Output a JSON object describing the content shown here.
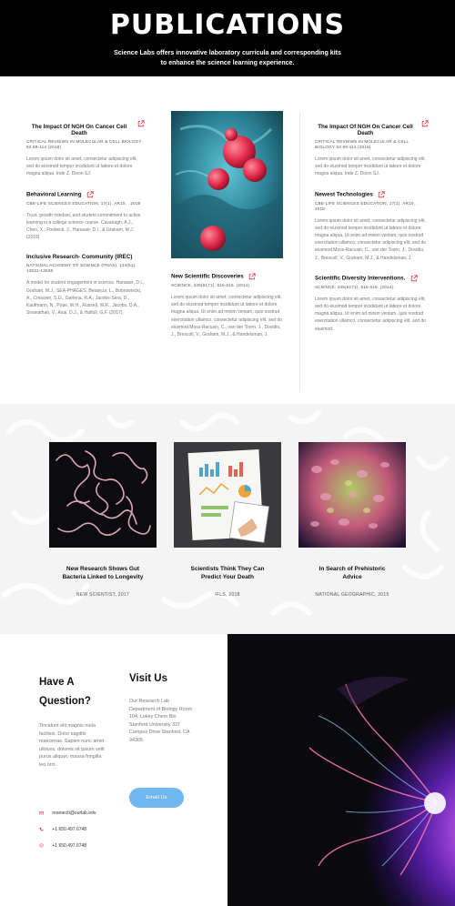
{
  "hero": {
    "title": "PUBLICATIONS",
    "subtitle": "Science Labs offers innovative laboratory curricula and corresponding kits to enhance the science learning experience."
  },
  "publications": {
    "left": [
      {
        "title": "The Impact Of NGH On Cancer Cell Death",
        "source": "CRITICAL REVIEWS IN MOLECULAR & CELL BIOLOGY 82 89-114 (2018)",
        "body": "Lorem ipsum dolor sit amet, consectetur adipiscing elit, sed do eiusmod tempor incididunt ut labore et dolore magna aliqua.  Inde Z, Dixon SJ."
      },
      {
        "title": "Behavioral Learning",
        "source": "CBE-LIFE SCIENCES EDUCATION, 17(1), AR10, . 2018",
        "body": "Trust, growth mindset, and student commitment to active learning in a college science course. Cavanagh, A.J., Chen, X., Fredeick, J., Hanauer, D.I., & Graham, M.J. (2018)"
      },
      {
        "title": "Inclusive Research- Community (IREC)",
        "source": "NATIONAL ACADEMY OF SCIENCE (PNAS), 134(51), 13531-13536",
        "body": " A model for student engagement in science. Hanauer, D.I., Graham, M.J., SEA-PHAGES, Betancur, L., Bobrownicki, A., Cresawn, S.G., Garlena, R.A., Jacobs-Sera, D., Kaufmann, N., Pope, W.H., Russell, W.R., Jacobs, D.A., Sivanathan, V., Asai, D.J., & Hatfull, G.F. (2017)."
      }
    ],
    "middle": [
      {
        "title": "New Scientific Discoveries",
        "source": "SCIENCE, 345(6171), 815-816. (2014).",
        "body": "Lorem ipsum dolor sit amet, consectetur adipiscing elit, sed do eiusmod tempor incididunt ut labore et dolore magna aliqua. Ut enim ad minim veniam, quis nostrud exercitation ullamco. consectetur adipiscing elit, sed do eiusmod.Moss-Racusin, C., van der Toorn, J., Dovidio, J., Brescoll, V., Graham, M.J., & Handelsman, J."
      }
    ],
    "right": [
      {
        "title": "The Impact Of NGH On Cancer Cell Death",
        "source": "CRITICAL REVIEWS IN MOLECULAR & CELL BIOLOGY 53 89-114 (2018)",
        "body": "Lorem ipsum dolor sit amet, consectetur adipiscing elit, sed do eiusmod tempor incididunt ut labore et dolore magna aliqua.  Inde Z, Dixon SJ."
      },
      {
        "title": "Newest Technologies",
        "source": "CBE-LIFE SCIENCES EDUCATION, 17(1), AR10, . 2018",
        "body": "Lorem ipsum dolor sit amet, consectetur adipiscing elit, sed do eiusmod tempor incididunt ut labore et dolore magna aliqua. Ut enim ad minim veniam, quis nostrud exercitation ullamco, consectetur adipiscing elit, sed do eiusmod.Moss-Racusin, C., van der Toorn, J., Dovidio, J., Brescoll, V., Graham, M.J., & Handelsman, J."
      },
      {
        "title": "Scientific Diversity Interventions.",
        "source": "SCIENCE, 345(6171), 815-816. (2014).",
        "body": "Lorem ipsum dolor sit amet, consectetur adipiscing elit, sed do eiusmod tempor incididunt ut labore et dolore magna aliqua. Ut enim ad minim veniam, quis nostrud exercitation ullamco, consectetur adipiscing elit, sed do eiusmod."
      }
    ]
  },
  "news": [
    {
      "title": "New Research Shows Gut Bacteria Linked to Longevity",
      "source": "NEW SCIENTIST, 2017"
    },
    {
      "title": "Scientists Think They Can Predict Your Death",
      "source": "IFLS, 2018"
    },
    {
      "title": "In Search of Prehistoric Advice",
      "source": "NATIONAL GEOGRAPHIC, 2015"
    }
  ],
  "contact": {
    "question_title": "Have A Question?",
    "question_body": "Tincidunt elit magnis nulla facilisis. Dolor sagittis maecenas. Sapien nunc amet ultrices, dolores sit ipsum velit purus aliquet, massa fringilla leo orci.",
    "visit_title": "Visit Us",
    "visit_body": "Our Research Lab Department of Biology Room 104, Lokey Chem Bio Stanford University 337 Campus Drive Stanford, CA 94305",
    "email_button": "Email Us",
    "email": "research@ourlab.edu",
    "phone": "+1 650.497.6748",
    "fax": "+1 650.497.6748"
  },
  "colors": {
    "accent": "#e0343f",
    "button": "#6fb8f0"
  }
}
